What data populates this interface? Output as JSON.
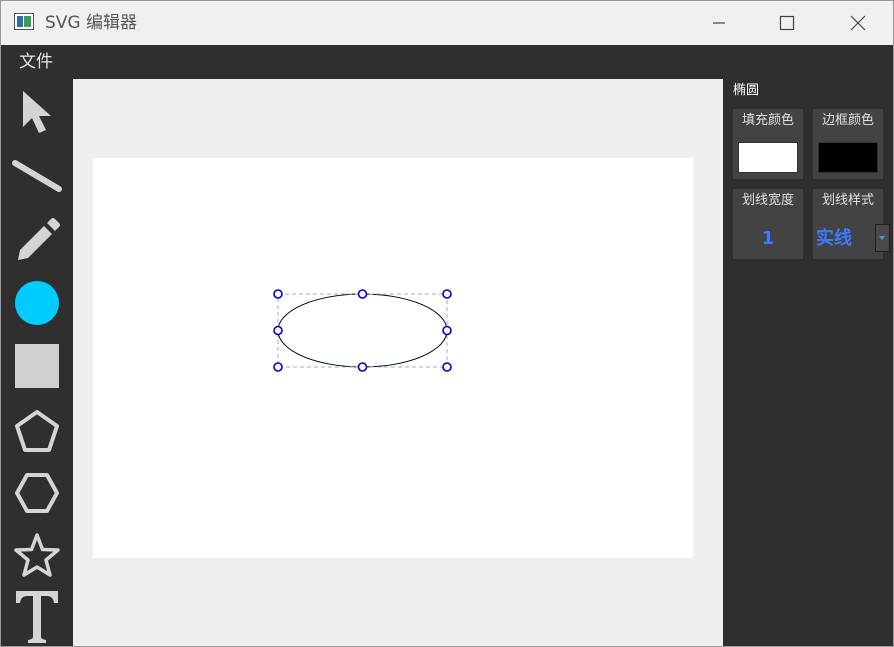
{
  "window": {
    "title": "SVG 编辑器"
  },
  "menu": {
    "items": [
      "文件"
    ]
  },
  "tools": [
    {
      "icon": "select-arrow-icon"
    },
    {
      "icon": "line-tool-icon"
    },
    {
      "icon": "pencil-tool-icon"
    },
    {
      "icon": "ellipse-tool-icon",
      "color": "#00ccff"
    },
    {
      "icon": "rectangle-tool-icon",
      "color": "#d0d0d0"
    },
    {
      "icon": "pentagon-tool-icon"
    },
    {
      "icon": "hexagon-tool-icon"
    },
    {
      "icon": "star-tool-icon"
    },
    {
      "icon": "text-tool-icon"
    }
  ],
  "canvas": {
    "selected_shape": "ellipse",
    "shape_fill": "#ffffff",
    "shape_stroke": "#000000",
    "handle_color": "#0000cc",
    "selection_color": "#8fb0e8"
  },
  "properties": {
    "title": "椭圆",
    "fill_color_label": "填充颜色",
    "fill_color": "#ffffff",
    "border_color_label": "边框颜色",
    "border_color": "#000000",
    "stroke_width_label": "划线宽度",
    "stroke_width_value": "1",
    "stroke_style_label": "划线样式",
    "stroke_style_value": "实线"
  }
}
